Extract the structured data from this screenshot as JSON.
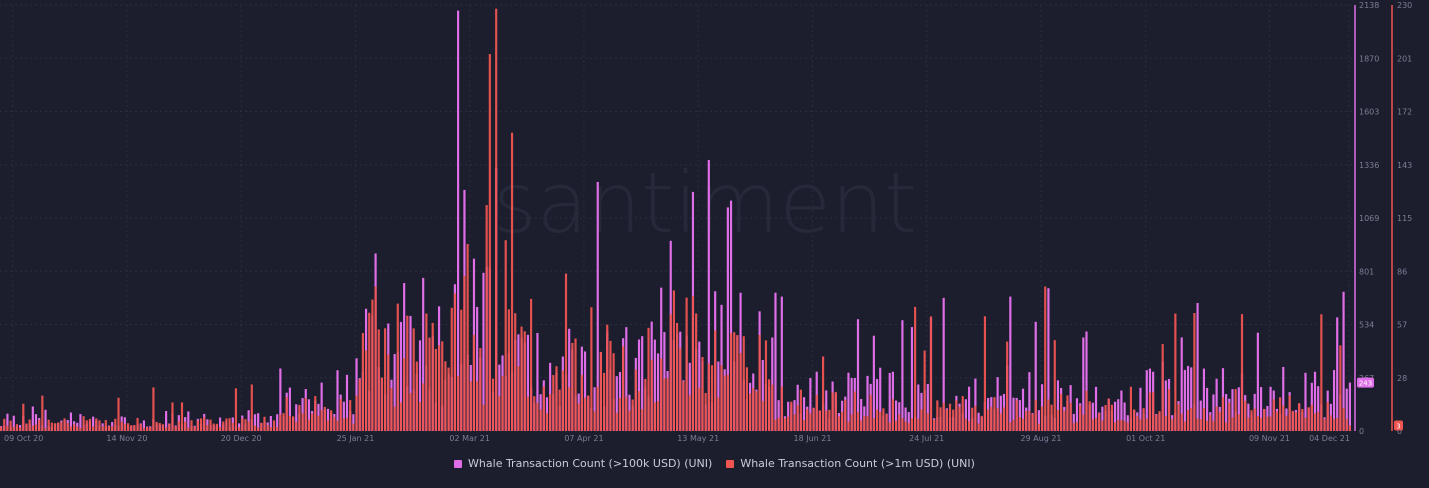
{
  "colors": {
    "background": "#1c1e2e",
    "grid": "#2a2d40",
    "tick_text": "#7a7f94",
    "series_100k": "#e06ee8",
    "series_1m": "#ef5450",
    "watermark": "#262939"
  },
  "watermark": "santiment",
  "chart_data": {
    "type": "bar",
    "x_tick_labels": [
      "09 Oct 20",
      "14 Nov 20",
      "20 Dec 20",
      "25 Jan 21",
      "02 Mar 21",
      "07 Apr 21",
      "13 May 21",
      "18 Jun 21",
      "24 Jul 21",
      "29 Aug 21",
      "01 Oct 21",
      "09 Nov 21",
      "04 Dec 21"
    ],
    "x_range": [
      "2020-10-05",
      "2021-12-04"
    ],
    "grid": true,
    "legend_position": "bottom-center",
    "y_left": {
      "ticks": [
        "0",
        "267",
        "534",
        "801",
        "1069",
        "1336",
        "1603",
        "1870",
        "2138"
      ],
      "ylim": [
        0,
        2138
      ],
      "current_value_label": "243"
    },
    "y_right": {
      "ticks": [
        "0",
        "28",
        "57",
        "86",
        "115",
        "143",
        "172",
        "201",
        "230"
      ],
      "ylim": [
        0,
        230
      ],
      "current_value_label": "3"
    },
    "series": [
      {
        "name": "Whale Transaction Count (>100k USD) (UNI)",
        "axis": "left",
        "approx_daily_values": [
          {
            "from": "2020-10-05",
            "to": "2020-12-31",
            "typical": 60,
            "max": 130
          },
          {
            "from": "2021-01-01",
            "to": "2021-01-24",
            "typical": 200,
            "max": 340
          },
          {
            "from": "2021-01-25",
            "to": "2021-02-24",
            "typical": 500,
            "max": 950
          },
          {
            "from": "2021-02-25",
            "to": "2021-03-20",
            "typical": 600,
            "max": 2110
          },
          {
            "from": "2021-03-21",
            "to": "2021-04-30",
            "typical": 380,
            "max": 1250
          },
          {
            "from": "2021-05-01",
            "to": "2021-06-05",
            "typical": 520,
            "max": 1350
          },
          {
            "from": "2021-06-06",
            "to": "2021-12-04",
            "typical": 220,
            "max": 820
          }
        ],
        "peaks": [
          {
            "date": "2021-02-26",
            "value": 2110
          },
          {
            "date": "2021-02-28",
            "value": 1210
          },
          {
            "date": "2021-03-10",
            "value": 1320
          },
          {
            "date": "2021-04-11",
            "value": 1250
          },
          {
            "date": "2021-05-16",
            "value": 1360
          },
          {
            "date": "2021-05-11",
            "value": 1200
          }
        ],
        "last_value": 243
      },
      {
        "name": "Whale Transaction Count (>1m USD) (UNI)",
        "axis": "right",
        "approx_daily_values": [
          {
            "from": "2020-10-05",
            "to": "2020-12-31",
            "typical": 5,
            "max": 28
          },
          {
            "from": "2021-01-01",
            "to": "2021-01-24",
            "typical": 12,
            "max": 20
          },
          {
            "from": "2021-01-25",
            "to": "2021-02-24",
            "typical": 45,
            "max": 88
          },
          {
            "from": "2021-02-25",
            "to": "2021-03-20",
            "typical": 55,
            "max": 228
          },
          {
            "from": "2021-03-21",
            "to": "2021-04-30",
            "typical": 35,
            "max": 85
          },
          {
            "from": "2021-05-01",
            "to": "2021-06-05",
            "typical": 50,
            "max": 85
          },
          {
            "from": "2021-06-06",
            "to": "2021-12-04",
            "typical": 15,
            "max": 78
          }
        ],
        "peaks": [
          {
            "date": "2021-03-10",
            "value": 228
          },
          {
            "date": "2021-03-07",
            "value": 122
          },
          {
            "date": "2021-03-13",
            "value": 103
          },
          {
            "date": "2021-03-01",
            "value": 101
          },
          {
            "date": "2021-04-01",
            "value": 85
          },
          {
            "date": "2021-08-30",
            "value": 78
          }
        ],
        "last_value": 3
      }
    ]
  }
}
